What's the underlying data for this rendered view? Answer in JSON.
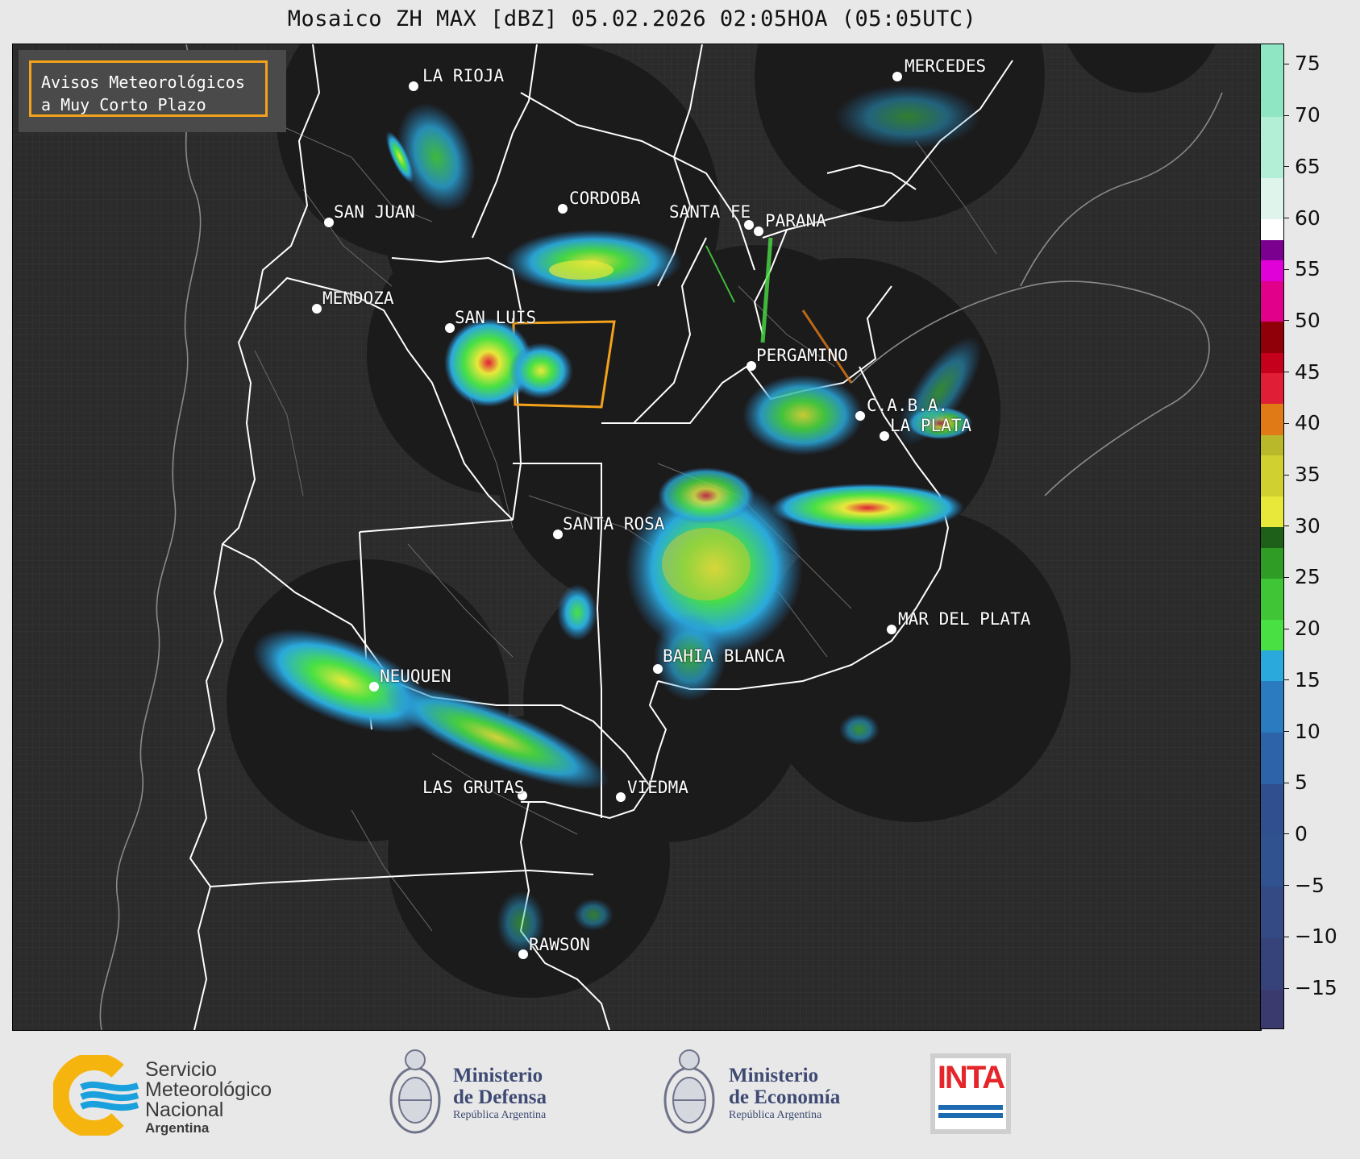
{
  "title": "Mosaico ZH MAX [dBZ] 05.02.2026 02:05HOA (05:05UTC)",
  "alert": {
    "line1": "Avisos Meteorológicos",
    "line2": "a Muy Corto Plazo"
  },
  "cities": [
    {
      "name": "LA RIOJA",
      "label": "LA RIOJA"
    },
    {
      "name": "MERCEDES",
      "label": "MERCEDES"
    },
    {
      "name": "SAN JUAN",
      "label": "SAN JUAN"
    },
    {
      "name": "CORDOBA",
      "label": "CORDOBA"
    },
    {
      "name": "SANTA FE",
      "label": "SANTA FE"
    },
    {
      "name": "PARANA",
      "label": "PARANA"
    },
    {
      "name": "MENDOZA",
      "label": "MENDOZA"
    },
    {
      "name": "SAN LUIS",
      "label": "SAN LUIS"
    },
    {
      "name": "PERGAMINO",
      "label": "PERGAMINO"
    },
    {
      "name": "C.A.B.A.",
      "label": "C.A.B.A."
    },
    {
      "name": "LA PLATA",
      "label": "LA PLATA"
    },
    {
      "name": "SANTA ROSA",
      "label": "SANTA ROSA"
    },
    {
      "name": "MAR DEL PLATA",
      "label": "MAR DEL PLATA"
    },
    {
      "name": "BAHIA BLANCA",
      "label": "BAHIA BLANCA"
    },
    {
      "name": "NEUQUEN",
      "label": "NEUQUEN"
    },
    {
      "name": "LAS GRUTAS",
      "label": "LAS GRUTAS"
    },
    {
      "name": "VIEDMA",
      "label": "VIEDMA"
    },
    {
      "name": "RAWSON",
      "label": "RAWSON"
    }
  ],
  "colorbar": {
    "unit": "dBZ",
    "min": -19,
    "max": 77,
    "ticks": [
      "75",
      "70",
      "65",
      "60",
      "55",
      "50",
      "45",
      "40",
      "35",
      "30",
      "25",
      "20",
      "15",
      "10",
      "5",
      "0",
      "−5",
      "−10",
      "−15"
    ],
    "tick_values": [
      75,
      70,
      65,
      60,
      55,
      50,
      45,
      40,
      35,
      30,
      25,
      20,
      15,
      10,
      5,
      0,
      -5,
      -10,
      -15
    ],
    "colors": {
      "cold": "#3b3a6e",
      "blue_low": "#2f4f8f",
      "blue": "#2a7bbf",
      "cyan": "#2aa9dc",
      "green_light": "#49e043",
      "green": "#2e9c25",
      "green_dark": "#1e5f1a",
      "yellow": "#e8e83a",
      "olive": "#b8b82a",
      "orange": "#e07a16",
      "red": "#e01e36",
      "dark_red": "#8f0008",
      "magenta": "#e000d8",
      "purple": "#7b008f",
      "white": "#ffffff",
      "mint": "#8ee6c2"
    }
  },
  "footer": {
    "smn": {
      "line1": "Servicio",
      "line2": "Meteorológico",
      "line3": "Nacional",
      "line4": "Argentina"
    },
    "defensa": {
      "line1": "Ministerio",
      "line2": "de Defensa",
      "line3": "República Argentina"
    },
    "economia": {
      "line1": "Ministerio",
      "line2": "de Economía",
      "line3": "República Argentina"
    },
    "inta": {
      "label": "INTA"
    },
    "colors": {
      "smn_yellow": "#f6b40e",
      "smn_blue": "#1aa0dc",
      "ministry_blue": "#3e4a73",
      "inta_red": "#e4262b",
      "inta_blue": "#1d6ab1"
    }
  }
}
